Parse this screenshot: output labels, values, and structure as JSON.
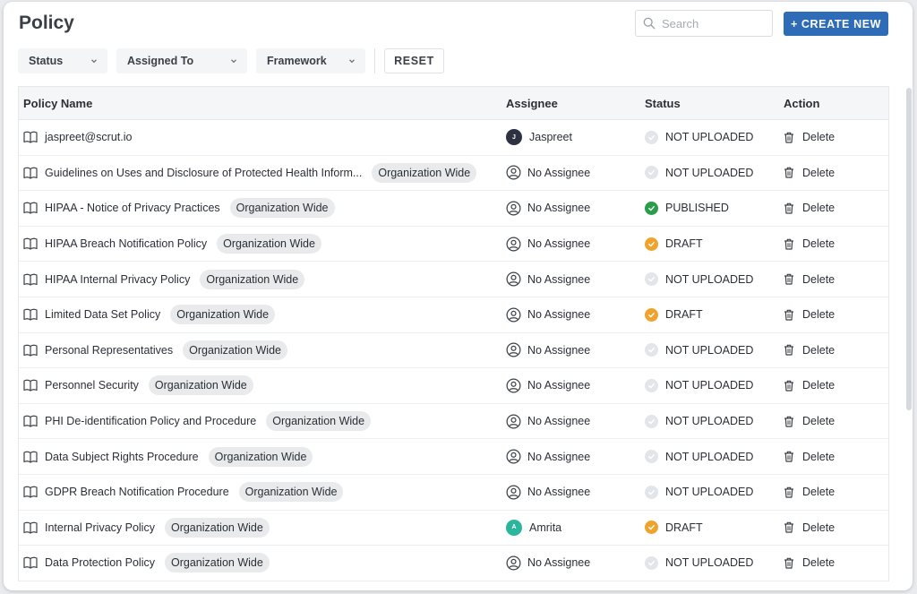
{
  "page": {
    "title": "Policy"
  },
  "search": {
    "placeholder": "Search",
    "value": ""
  },
  "create_button": {
    "label": "+ CREATE NEW",
    "color": "#2e6cb7"
  },
  "filters": {
    "status": "Status",
    "assigned_to": "Assigned To",
    "framework": "Framework",
    "reset": "RESET"
  },
  "table": {
    "headers": {
      "name": "Policy Name",
      "assignee": "Assignee",
      "status": "Status",
      "action": "Action"
    },
    "rows": [
      {
        "name": "jaspreet@scrut.io",
        "tag": "",
        "assignee": "Jaspreet",
        "avatar": "J",
        "avatar_color": "#2d3142",
        "status": "NOT UPLOADED",
        "status_type": "not-uploaded",
        "action": "Delete"
      },
      {
        "name": "Guidelines on Uses and Disclosure of Protected Health Inform...",
        "tag": "Organization Wide",
        "assignee": "No Assignee",
        "avatar": "",
        "avatar_color": "",
        "status": "NOT UPLOADED",
        "status_type": "not-uploaded",
        "action": "Delete"
      },
      {
        "name": "HIPAA - Notice of Privacy Practices",
        "tag": "Organization Wide",
        "assignee": "No Assignee",
        "avatar": "",
        "avatar_color": "",
        "status": "PUBLISHED",
        "status_type": "published",
        "action": "Delete"
      },
      {
        "name": "HIPAA Breach Notification Policy",
        "tag": "Organization Wide",
        "assignee": "No Assignee",
        "avatar": "",
        "avatar_color": "",
        "status": "DRAFT",
        "status_type": "draft",
        "action": "Delete"
      },
      {
        "name": "HIPAA Internal Privacy Policy",
        "tag": "Organization Wide",
        "assignee": "No Assignee",
        "avatar": "",
        "avatar_color": "",
        "status": "NOT UPLOADED",
        "status_type": "not-uploaded",
        "action": "Delete"
      },
      {
        "name": "Limited Data Set Policy",
        "tag": "Organization Wide",
        "assignee": "No Assignee",
        "avatar": "",
        "avatar_color": "",
        "status": "DRAFT",
        "status_type": "draft",
        "action": "Delete"
      },
      {
        "name": "Personal Representatives",
        "tag": "Organization Wide",
        "assignee": "No Assignee",
        "avatar": "",
        "avatar_color": "",
        "status": "NOT UPLOADED",
        "status_type": "not-uploaded",
        "action": "Delete"
      },
      {
        "name": "Personnel Security",
        "tag": "Organization Wide",
        "assignee": "No Assignee",
        "avatar": "",
        "avatar_color": "",
        "status": "NOT UPLOADED",
        "status_type": "not-uploaded",
        "action": "Delete"
      },
      {
        "name": "PHI De-identification Policy and Procedure",
        "tag": "Organization Wide",
        "assignee": "No Assignee",
        "avatar": "",
        "avatar_color": "",
        "status": "NOT UPLOADED",
        "status_type": "not-uploaded",
        "action": "Delete"
      },
      {
        "name": "Data Subject Rights Procedure",
        "tag": "Organization Wide",
        "assignee": "No Assignee",
        "avatar": "",
        "avatar_color": "",
        "status": "NOT UPLOADED",
        "status_type": "not-uploaded",
        "action": "Delete"
      },
      {
        "name": "GDPR Breach Notification Procedure",
        "tag": "Organization Wide",
        "assignee": "No Assignee",
        "avatar": "",
        "avatar_color": "",
        "status": "NOT UPLOADED",
        "status_type": "not-uploaded",
        "action": "Delete"
      },
      {
        "name": "Internal Privacy Policy",
        "tag": "Organization Wide",
        "assignee": "Amrita",
        "avatar": "A",
        "avatar_color": "#2bb59a",
        "status": "DRAFT",
        "status_type": "draft",
        "action": "Delete"
      },
      {
        "name": "Data Protection Policy",
        "tag": "Organization Wide",
        "assignee": "No Assignee",
        "avatar": "",
        "avatar_color": "",
        "status": "NOT UPLOADED",
        "status_type": "not-uploaded",
        "action": "Delete"
      }
    ]
  },
  "status_colors": {
    "published": "#2a9d4b",
    "draft": "#f0a32c",
    "not-uploaded": "#e2e5e9"
  },
  "icons": {
    "book": "book-icon",
    "person": "user-circle-icon",
    "trash": "trash-icon",
    "search": "search-icon",
    "chevron": "chevron-down-icon"
  }
}
